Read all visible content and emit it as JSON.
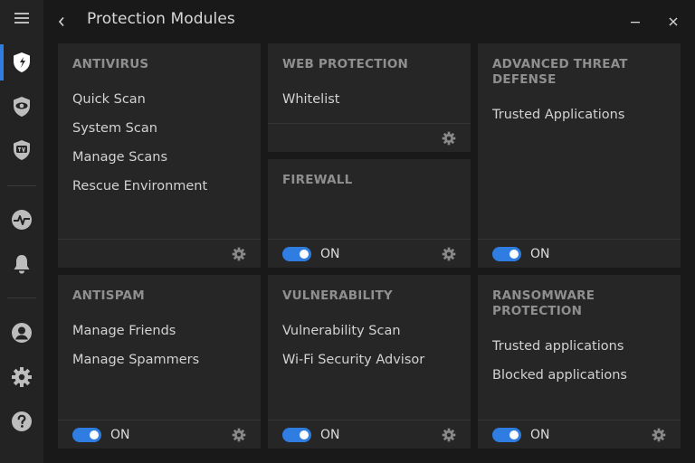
{
  "window": {
    "title": "Protection Modules",
    "menu_icon": "hamburger-icon",
    "back_icon": "chevron-left-icon",
    "minimize_icon": "minimize-icon",
    "close_icon": "close-icon"
  },
  "sidebar": {
    "items": [
      {
        "id": "protection",
        "icon": "shield-icon",
        "active": true
      },
      {
        "id": "privacy",
        "icon": "eye-shield-icon",
        "active": false
      },
      {
        "id": "utilities",
        "icon": "tv-shield-icon",
        "active": false
      },
      {
        "id": "activity",
        "icon": "activity-icon",
        "active": false
      },
      {
        "id": "notifications",
        "icon": "bell-icon",
        "active": false
      },
      {
        "id": "account",
        "icon": "user-icon",
        "active": false
      },
      {
        "id": "settings",
        "icon": "gear-icon",
        "active": false
      },
      {
        "id": "help",
        "icon": "help-icon",
        "active": false
      }
    ]
  },
  "accent_color": "#2f7de1",
  "cards": {
    "antivirus": {
      "title": "ANTIVIRUS",
      "links": [
        "Quick Scan",
        "System Scan",
        "Manage Scans",
        "Rescue Environment"
      ]
    },
    "web_protection": {
      "title": "WEB PROTECTION",
      "links": [
        "Whitelist"
      ]
    },
    "advanced_threat_defense": {
      "title_line1": "ADVANCED THREAT",
      "title_line2": "DEFENSE",
      "links": [
        "Trusted Applications"
      ],
      "toggle_label": "ON"
    },
    "firewall": {
      "title": "FIREWALL",
      "toggle_label": "ON"
    },
    "antispam": {
      "title": "ANTISPAM",
      "links": [
        "Manage Friends",
        "Manage Spammers"
      ],
      "toggle_label": "ON"
    },
    "vulnerability": {
      "title": "VULNERABILITY",
      "links": [
        "Vulnerability Scan",
        "Wi-Fi Security Advisor"
      ],
      "toggle_label": "ON"
    },
    "ransomware_protection": {
      "title_line1": "RANSOMWARE",
      "title_line2": "PROTECTION",
      "links": [
        "Trusted applications",
        "Blocked applications"
      ],
      "toggle_label": "ON"
    }
  }
}
